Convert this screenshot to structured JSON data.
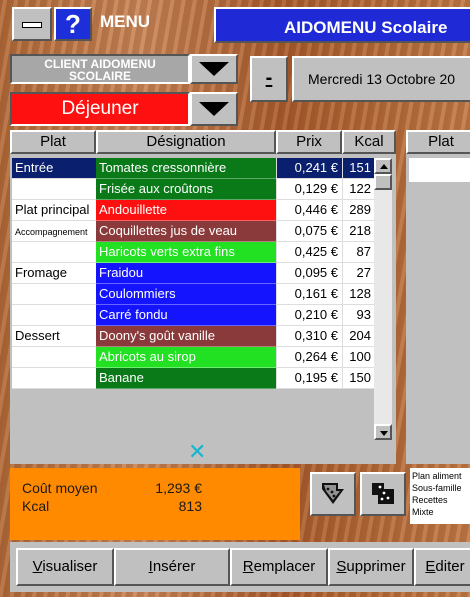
{
  "header": {
    "help_label": "?",
    "menu_label": "MENU",
    "app_title": "AIDOMENU Scolaire"
  },
  "client": {
    "label": "CLIENT AIDOMENU SCOLAIRE"
  },
  "date": {
    "minus_label": "-",
    "value": "Mercredi 13 Octobre 20"
  },
  "meal": {
    "label": "Déjeuner"
  },
  "columns": {
    "plat": "Plat",
    "designation": "Désignation",
    "prix": "Prix",
    "kcal": "Kcal",
    "plat_right": "Plat"
  },
  "colors": {
    "dark_green": "#0a7a18",
    "red": "#ff1010",
    "brown": "#8a3a3a",
    "bright_green": "#22e022",
    "blue": "#1414ff",
    "selection": "#0a1f6e"
  },
  "rows": [
    {
      "category": "Entrée",
      "designation": "Tomates cressonnière",
      "prix": "0,241 €",
      "kcal": "151",
      "color": "#0a7a18",
      "selected": true
    },
    {
      "category": "",
      "designation": "Frisée aux croûtons",
      "prix": "0,129 €",
      "kcal": "122",
      "color": "#0a7a18",
      "selected": false
    },
    {
      "category": "Plat principal",
      "designation": "Andouillette",
      "prix": "0,446 €",
      "kcal": "289",
      "color": "#ff1010",
      "selected": false
    },
    {
      "category": "Accompagnement",
      "designation": "Coquillettes jus de veau",
      "prix": "0,075 €",
      "kcal": "218",
      "color": "#8a3a3a",
      "selected": false,
      "small": true
    },
    {
      "category": "",
      "designation": "Haricots verts extra fins",
      "prix": "0,425 €",
      "kcal": "87",
      "color": "#22e022",
      "selected": false
    },
    {
      "category": "Fromage",
      "designation": "Fraidou",
      "prix": "0,095 €",
      "kcal": "27",
      "color": "#1414ff",
      "selected": false
    },
    {
      "category": "",
      "designation": "Coulommiers",
      "prix": "0,161 €",
      "kcal": "128",
      "color": "#1414ff",
      "selected": false
    },
    {
      "category": "",
      "designation": "Carré fondu",
      "prix": "0,210 €",
      "kcal": "93",
      "color": "#1414ff",
      "selected": false
    },
    {
      "category": "Dessert",
      "designation": "Doony's goût vanille",
      "prix": "0,310 €",
      "kcal": "204",
      "color": "#8a3a3a",
      "selected": false
    },
    {
      "category": "",
      "designation": "Abricots au sirop",
      "prix": "0,264 €",
      "kcal": "100",
      "color": "#22e022",
      "selected": false
    },
    {
      "category": "",
      "designation": "Banane",
      "prix": "0,195 €",
      "kcal": "150",
      "color": "#0a7a18",
      "selected": false
    }
  ],
  "summary": {
    "cost_label": "Coût moyen",
    "cost_value": "1,293 €",
    "kcal_label": "Kcal",
    "kcal_value": "813"
  },
  "legend": {
    "items": [
      "Plan aliment",
      "Sous-famille",
      "Recettes",
      "Mixte"
    ]
  },
  "buttons": {
    "visualiser": "Visualiser",
    "inserer": "Insérer",
    "remplacer": "Remplacer",
    "supprimer": "Supprimer",
    "editer": "Editer"
  },
  "icons": {
    "minimize": "minimize-icon",
    "help": "help-icon",
    "dropdown": "triangle-down-icon",
    "scroll_up": "arrow-up-icon",
    "scroll_down": "arrow-down-icon",
    "logo": "x-logo-icon",
    "export": "export-icon",
    "import": "import-icon"
  }
}
